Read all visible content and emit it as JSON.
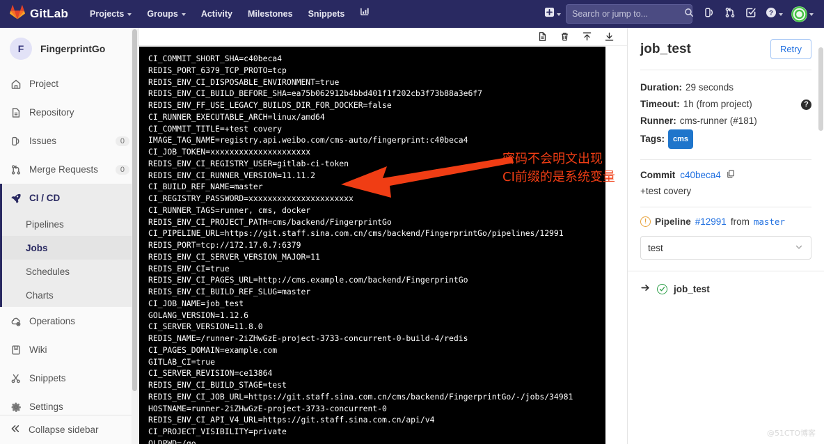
{
  "navbar": {
    "brand": "GitLab",
    "brand_icon": "gitlab-tanuki-logo",
    "links": [
      {
        "label": "Projects",
        "has_caret": true
      },
      {
        "label": "Groups",
        "has_caret": true
      },
      {
        "label": "Activity",
        "has_caret": false
      },
      {
        "label": "Milestones",
        "has_caret": false
      },
      {
        "label": "Snippets",
        "has_caret": false
      }
    ],
    "analytics_icon": "chart-bar-icon",
    "create_icon": "plus-square-icon",
    "search": {
      "placeholder": "Search or jump to...",
      "value": "",
      "icon": "search-icon"
    },
    "issues_icon": "issues-icon",
    "merge_requests_icon": "merge-request-icon",
    "todos_icon": "todo-check-icon",
    "help_icon": "question-circle-icon",
    "avatar_icon": "user-avatar"
  },
  "sidebar": {
    "project": {
      "initial": "F",
      "name": "FingerprintGo"
    },
    "items": [
      {
        "label": "Project",
        "icon": "home-icon",
        "badge": "",
        "active": false
      },
      {
        "label": "Repository",
        "icon": "document-icon",
        "badge": "",
        "active": false
      },
      {
        "label": "Issues",
        "icon": "issues-icon",
        "badge": "0",
        "active": false
      },
      {
        "label": "Merge Requests",
        "icon": "merge-request-icon",
        "badge": "0",
        "active": false
      },
      {
        "label": "CI / CD",
        "icon": "rocket-icon",
        "badge": "",
        "active": true
      }
    ],
    "subitems": [
      {
        "label": "Pipelines",
        "active": false
      },
      {
        "label": "Jobs",
        "active": true
      },
      {
        "label": "Schedules",
        "active": false
      },
      {
        "label": "Charts",
        "active": false
      }
    ],
    "items_after": [
      {
        "label": "Operations",
        "icon": "cloud-gear-icon",
        "badge": "",
        "active": false
      },
      {
        "label": "Wiki",
        "icon": "book-icon",
        "badge": "",
        "active": false
      },
      {
        "label": "Snippets",
        "icon": "scissors-icon",
        "badge": "",
        "active": false
      },
      {
        "label": "Settings",
        "icon": "gear-icon",
        "badge": "",
        "active": false
      }
    ],
    "collapse": {
      "label": "Collapse sidebar",
      "icon": "chevron-double-left-icon"
    }
  },
  "log_toolbar": {
    "raw_icon": "raw-file-icon",
    "erase_icon": "trash-erase-icon",
    "scroll_top_icon": "scroll-to-top-icon",
    "scroll_bottom_icon": "scroll-to-bottom-icon"
  },
  "console": {
    "lines": [
      "CI_COMMIT_SHORT_SHA=c40beca4",
      "REDIS_PORT_6379_TCP_PROTO=tcp",
      "REDIS_ENV_CI_DISPOSABLE_ENVIRONMENT=true",
      "REDIS_ENV_CI_BUILD_BEFORE_SHA=ea75b062912b4bbd401f1f202cb3f73b88a3e6f7",
      "REDIS_ENV_FF_USE_LEGACY_BUILDS_DIR_FOR_DOCKER=false",
      "CI_RUNNER_EXECUTABLE_ARCH=linux/amd64",
      "CI_COMMIT_TITLE=+test covery",
      "IMAGE_TAG_NAME=registry.api.weibo.com/cms-auto/fingerprint:c40beca4",
      "CI_JOB_TOKEN=xxxxxxxxxxxxxxxxxxxxx",
      "REDIS_ENV_CI_REGISTRY_USER=gitlab-ci-token",
      "REDIS_ENV_CI_RUNNER_VERSION=11.11.2",
      "CI_BUILD_REF_NAME=master",
      "CI_REGISTRY_PASSWORD=xxxxxxxxxxxxxxxxxxxxxx",
      "CI_RUNNER_TAGS=runner, cms, docker",
      "REDIS_ENV_CI_PROJECT_PATH=cms/backend/FingerprintGo",
      "CI_PIPELINE_URL=https://git.staff.sina.com.cn/cms/backend/FingerprintGo/pipelines/12991",
      "REDIS_PORT=tcp://172.17.0.7:6379",
      "REDIS_ENV_CI_SERVER_VERSION_MAJOR=11",
      "REDIS_ENV_CI=true",
      "REDIS_ENV_CI_PAGES_URL=http://cms.example.com/backend/FingerprintGo",
      "REDIS_ENV_CI_BUILD_REF_SLUG=master",
      "CI_JOB_NAME=job_test",
      "GOLANG_VERSION=1.12.6",
      "CI_SERVER_VERSION=11.8.0",
      "REDIS_NAME=/runner-2iZHwGzE-project-3733-concurrent-0-build-4/redis",
      "CI_PAGES_DOMAIN=example.com",
      "GITLAB_CI=true",
      "CI_SERVER_REVISION=ce13864",
      "REDIS_ENV_CI_BUILD_STAGE=test",
      "REDIS_ENV_CI_JOB_URL=https://git.staff.sina.com.cn/cms/backend/FingerprintGo/-/jobs/34981",
      "HOSTNAME=runner-2iZHwGzE-project-3733-concurrent-0",
      "REDIS_ENV_CI_API_V4_URL=https://git.staff.sina.com.cn/api/v4",
      "CI_PROJECT_VISIBILITY=private",
      "OLDPWD=/go"
    ]
  },
  "annotation": {
    "line1": "密码不会明文出现",
    "line2": "CI前缀的是系统变量",
    "color": "#f03d14",
    "arrow_icon": "left-pointing-arrow"
  },
  "right_panel": {
    "title": "job_test",
    "retry_label": "Retry",
    "duration_label": "Duration:",
    "duration_value": "29 seconds",
    "timeout_label": "Timeout:",
    "timeout_value": "1h (from project)",
    "timeout_help_icon": "question-circle-icon",
    "runner_label": "Runner:",
    "runner_value": "cms-runner (#181)",
    "tags_label": "Tags:",
    "tags": [
      "cms"
    ],
    "commit_label": "Commit",
    "commit_sha": "c40beca4",
    "copy_icon": "copy-icon",
    "commit_message": "+test covery",
    "pipeline_status_icon": "warning-circle-icon",
    "pipeline_label": "Pipeline",
    "pipeline_id": "#12991",
    "pipeline_from": "from",
    "pipeline_ref": "master",
    "stage_selected": "test",
    "stage_chevron_icon": "chevron-down-icon",
    "job_arrow_icon": "arrow-right-icon",
    "job_status_icon": "check-circle-icon",
    "job_name": "job_test"
  },
  "watermark": "@51CTO博客"
}
